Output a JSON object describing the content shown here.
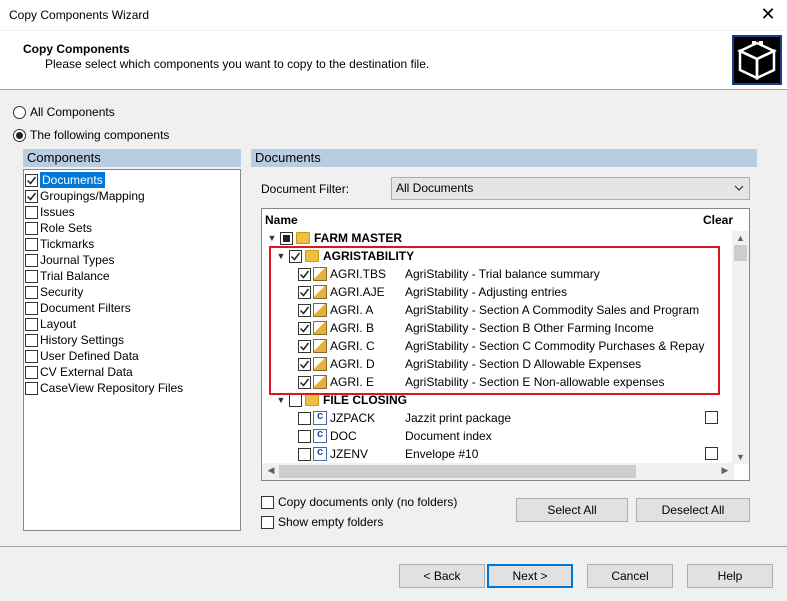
{
  "window": {
    "title": "Copy Components Wizard",
    "close": "✕"
  },
  "header": {
    "title": "Copy Components",
    "subtitle": "Please select which components you want to copy to the destination file."
  },
  "mode": {
    "all_label": "All Components",
    "following_label": "The following components",
    "selected": "following"
  },
  "components": {
    "title": "Components",
    "items": [
      {
        "label": "Documents",
        "checked": true,
        "selected": true
      },
      {
        "label": "Groupings/Mapping",
        "checked": true
      },
      {
        "label": "Issues",
        "checked": false
      },
      {
        "label": "Role Sets",
        "checked": false
      },
      {
        "label": "Tickmarks",
        "checked": false
      },
      {
        "label": "Journal Types",
        "checked": false
      },
      {
        "label": "Trial Balance",
        "checked": false
      },
      {
        "label": "Security",
        "checked": false
      },
      {
        "label": "Document Filters",
        "checked": false
      },
      {
        "label": "Layout",
        "checked": false
      },
      {
        "label": "History Settings",
        "checked": false
      },
      {
        "label": "User Defined Data",
        "checked": false
      },
      {
        "label": "CV External Data",
        "checked": false
      },
      {
        "label": "CaseView Repository Files",
        "checked": false
      }
    ]
  },
  "documents": {
    "title": "Documents",
    "filter_label": "Document Filter:",
    "filter_value": "All Documents",
    "col_name": "Name",
    "col_clear": "Clear",
    "tree": [
      {
        "type": "folder",
        "level": 0,
        "name": "FARM MASTER",
        "check": "partial",
        "expanded": true
      },
      {
        "type": "folder",
        "level": 1,
        "name": "AGRISTABILITY",
        "check": "on",
        "expanded": true
      },
      {
        "type": "doc",
        "level": 2,
        "code": "AGRI.TBS",
        "desc": "AgriStability - Trial balance summary",
        "check": "on",
        "icon": "doc"
      },
      {
        "type": "doc",
        "level": 2,
        "code": "AGRI.AJE",
        "desc": "AgriStability - Adjusting entries",
        "check": "on",
        "icon": "doc"
      },
      {
        "type": "doc",
        "level": 2,
        "code": "AGRI. A",
        "desc": "AgriStability - Section A Commodity Sales and Program",
        "check": "on",
        "icon": "doc"
      },
      {
        "type": "doc",
        "level": 2,
        "code": "AGRI. B",
        "desc": "AgriStability - Section B Other Farming Income",
        "check": "on",
        "icon": "doc"
      },
      {
        "type": "doc",
        "level": 2,
        "code": "AGRI. C",
        "desc": "AgriStability - Section C Commodity Purchases & Repay",
        "check": "on",
        "icon": "doc"
      },
      {
        "type": "doc",
        "level": 2,
        "code": "AGRI. D",
        "desc": "AgriStability - Section D Allowable Expenses",
        "check": "on",
        "icon": "doc"
      },
      {
        "type": "doc",
        "level": 2,
        "code": "AGRI. E",
        "desc": "AgriStability - Section E Non-allowable expenses",
        "check": "on",
        "icon": "doc"
      },
      {
        "type": "folder",
        "level": 1,
        "name": "FILE CLOSING",
        "check": "off",
        "expanded": true
      },
      {
        "type": "doc",
        "level": 2,
        "code": "JZPACK",
        "desc": "Jazzit print package",
        "check": "off",
        "icon": "c",
        "clear": true
      },
      {
        "type": "doc",
        "level": 2,
        "code": "DOC",
        "desc": "Document index",
        "check": "off",
        "icon": "c",
        "clear": false
      },
      {
        "type": "doc",
        "level": 2,
        "code": "JZENV",
        "desc": "Envelope #10",
        "check": "off",
        "icon": "c",
        "clear": true
      }
    ],
    "copy_only_label": "Copy documents only (no folders)",
    "show_empty_label": "Show empty folders",
    "select_all": "Select All",
    "deselect_all": "Deselect All"
  },
  "footer": {
    "back": "< Back",
    "next": "Next >",
    "cancel": "Cancel",
    "help": "Help"
  }
}
